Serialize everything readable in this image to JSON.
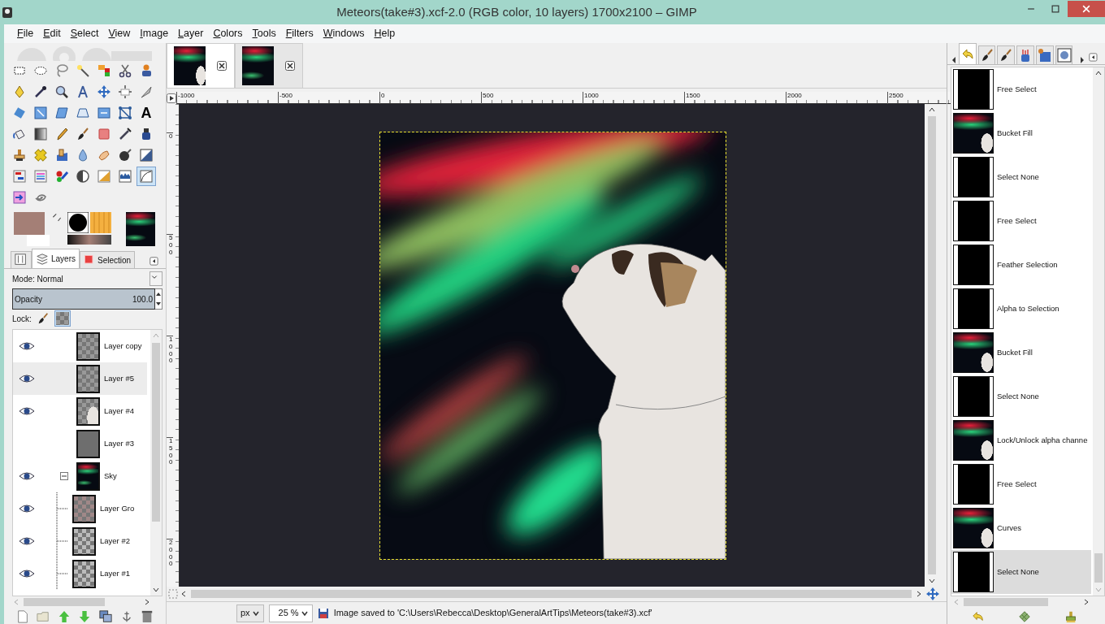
{
  "window": {
    "title": "Meteors(take#3).xcf-2.0 (RGB color, 10 layers) 1700x2100 – GIMP"
  },
  "menu": [
    "File",
    "Edit",
    "Select",
    "View",
    "Image",
    "Layer",
    "Colors",
    "Tools",
    "Filters",
    "Windows",
    "Help"
  ],
  "toolbox": {
    "tools": [
      {
        "kind": "rect",
        "selected": false
      },
      {
        "kind": "ellipse",
        "selected": false
      },
      {
        "kind": "lasso",
        "selected": false
      },
      {
        "kind": "wand",
        "selected": false
      },
      {
        "kind": "colorsel",
        "selected": false
      },
      {
        "kind": "scissors",
        "selected": false
      },
      {
        "kind": "fgsel",
        "selected": false
      },
      {
        "kind": "paths",
        "selected": false
      },
      {
        "kind": "picker",
        "selected": false
      },
      {
        "kind": "zoom",
        "selected": false
      },
      {
        "kind": "measure",
        "selected": false
      },
      {
        "kind": "move",
        "selected": false
      },
      {
        "kind": "align",
        "selected": false
      },
      {
        "kind": "crop",
        "selected": false
      },
      {
        "kind": "rotate",
        "selected": false
      },
      {
        "kind": "scale",
        "selected": false
      },
      {
        "kind": "shear",
        "selected": false
      },
      {
        "kind": "perspective",
        "selected": false
      },
      {
        "kind": "flip",
        "selected": false
      },
      {
        "kind": "cage",
        "selected": false
      },
      {
        "kind": "text",
        "glyph": "A",
        "selected": false
      },
      {
        "kind": "bucket",
        "selected": false
      },
      {
        "kind": "gradient",
        "selected": false
      },
      {
        "kind": "pencil",
        "selected": false
      },
      {
        "kind": "brush",
        "selected": false
      },
      {
        "kind": "eraser",
        "selected": false
      },
      {
        "kind": "airbrush",
        "selected": false
      },
      {
        "kind": "ink",
        "selected": false
      },
      {
        "kind": "clone",
        "selected": false
      },
      {
        "kind": "heal",
        "selected": false
      },
      {
        "kind": "pclone",
        "selected": false
      },
      {
        "kind": "blur",
        "selected": false
      },
      {
        "kind": "smudge",
        "selected": false
      },
      {
        "kind": "dodge",
        "selected": false
      },
      {
        "kind": "halfsquare",
        "selected": false
      },
      {
        "kind": "balance",
        "selected": false
      },
      {
        "kind": "hue",
        "selected": false
      },
      {
        "kind": "colorize",
        "selected": false
      },
      {
        "kind": "brightness",
        "selected": false
      },
      {
        "kind": "threshold",
        "selected": false
      },
      {
        "kind": "levels",
        "selected": false
      },
      {
        "kind": "curves",
        "selected": true
      },
      {
        "kind": "posterize",
        "selected": false
      },
      {
        "kind": "desaturate",
        "selected": false
      }
    ],
    "foreground": {
      "color": "#a47f76"
    },
    "background": {
      "color": "#ffffff"
    }
  },
  "image_tabs": [
    {
      "kind": "art",
      "selected": true
    },
    {
      "kind": "sky",
      "selected": false
    }
  ],
  "rulers": {
    "horizontal": [
      "-1000",
      "-500",
      "0",
      "500",
      "1000",
      "1500",
      "2000",
      "2500"
    ],
    "vertical": [
      "0",
      "500",
      "1000",
      "1500",
      "2000"
    ]
  },
  "layers_dock": {
    "tabs": [
      {
        "kind": "icon",
        "selected": false
      },
      {
        "kind": "layers",
        "label": "Layers",
        "selected": true
      },
      {
        "kind": "selection",
        "label": "Selection",
        "selected": false
      }
    ],
    "mode": "Mode: Normal",
    "opacity": {
      "label": "Opacity",
      "value": "100.0",
      "level": 1
    },
    "lock": {
      "label": "Lock:",
      "pixels": false,
      "alpha": true
    },
    "layers": [
      {
        "name": "Layer copy",
        "kind": "checker",
        "visible": true,
        "selected": false
      },
      {
        "name": "Layer #5",
        "kind": "checker",
        "visible": true,
        "selected": true
      },
      {
        "name": "Layer #4",
        "kind": "figure",
        "visible": true,
        "selected": false
      },
      {
        "name": "Layer #3",
        "kind": "gray",
        "visible": false,
        "selected": false
      },
      {
        "name": "Sky",
        "kind": "sky",
        "visible": true,
        "selected": false,
        "expanded": true,
        "children": [
          {
            "name": "Layer Gro",
            "kind": "tint",
            "visible": true,
            "selected": false
          },
          {
            "name": "Layer #2",
            "kind": "streaks",
            "visible": true,
            "selected": false
          },
          {
            "name": "Layer #1",
            "kind": "streaks",
            "visible": true,
            "selected": false
          }
        ]
      }
    ]
  },
  "history_dock": {
    "tabs": [
      {
        "kind": "undo",
        "selected": true
      },
      {
        "kind": "brush",
        "selected": false
      },
      {
        "kind": "brush",
        "selected": false
      },
      {
        "kind": "cup",
        "selected": false
      },
      {
        "kind": "pattern",
        "selected": false
      },
      {
        "kind": "picture",
        "selected": false
      }
    ],
    "items": [
      {
        "label": "Free Select",
        "kind": "dark",
        "selected": false
      },
      {
        "label": "Bucket Fill",
        "kind": "art",
        "selected": false
      },
      {
        "label": "Select None",
        "kind": "dark",
        "selected": false
      },
      {
        "label": "Free Select",
        "kind": "dark",
        "selected": false
      },
      {
        "label": "Feather Selection",
        "kind": "dark",
        "selected": false
      },
      {
        "label": "Alpha to Selection",
        "kind": "dark",
        "selected": false
      },
      {
        "label": "Bucket Fill",
        "kind": "art",
        "selected": false
      },
      {
        "label": "Select None",
        "kind": "dark",
        "selected": false
      },
      {
        "label": "Lock/Unlock alpha channe",
        "kind": "art",
        "selected": false
      },
      {
        "label": "Free Select",
        "kind": "dark",
        "selected": false
      },
      {
        "label": "Curves",
        "kind": "art",
        "selected": false
      },
      {
        "label": "Select None",
        "kind": "dark",
        "selected": true
      }
    ]
  },
  "status": {
    "unit": "px",
    "zoom": "25 %",
    "message": "Image saved to 'C:\\Users\\Rebecca\\Desktop\\GeneralArtTips\\Meteors(take#3).xcf'"
  }
}
